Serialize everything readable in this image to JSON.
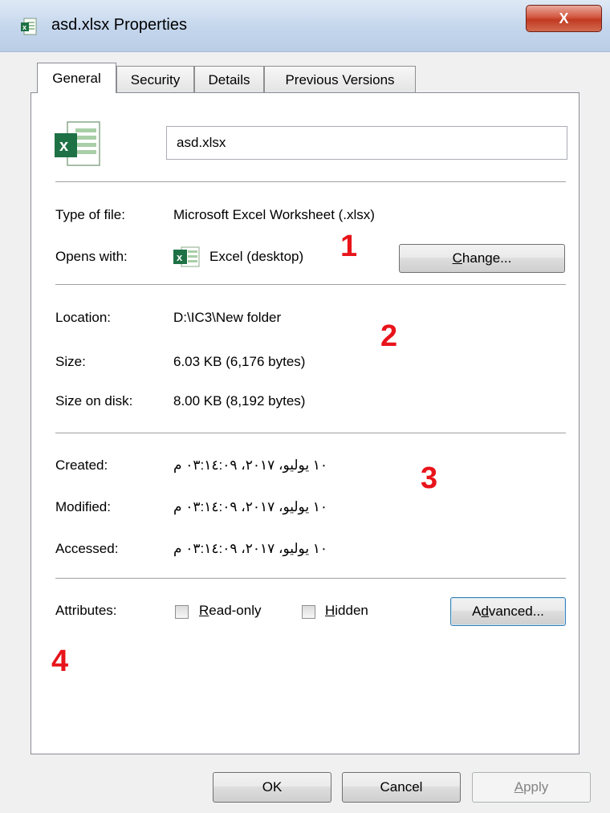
{
  "window": {
    "title": "asd.xlsx Properties",
    "close_label": "X"
  },
  "tabs": [
    {
      "label": "General",
      "active": true
    },
    {
      "label": "Security"
    },
    {
      "label": "Details"
    },
    {
      "label": "Previous Versions"
    }
  ],
  "file": {
    "name": "asd.xlsx",
    "type_label": "Type of file:",
    "type_value": "Microsoft Excel Worksheet (.xlsx)",
    "opens_label": "Opens with:",
    "opens_value": "Excel (desktop)",
    "change_prefix": "C",
    "change_rest": "hange..."
  },
  "location": {
    "location_label": "Location:",
    "location_value": "D:\\IC3\\New folder",
    "size_label": "Size:",
    "size_value": "6.03 KB (6,176 bytes)",
    "disk_label": "Size on disk:",
    "disk_value": "8.00 KB (8,192 bytes)"
  },
  "dates": {
    "created_label": "Created:",
    "created_value": "١٠ يوليو، ٢٠١٧، ٠٣:١٤:٠٩ م",
    "modified_label": "Modified:",
    "modified_value": "١٠ يوليو، ٢٠١٧، ٠٣:١٤:٠٩ م",
    "accessed_label": "Accessed:",
    "accessed_value": "١٠ يوليو، ٢٠١٧، ٠٣:١٤:٠٩ م"
  },
  "attributes": {
    "label": "Attributes:",
    "readonly_prefix": "R",
    "readonly_rest": "ead-only",
    "hidden_prefix": "H",
    "hidden_rest": "idden",
    "advanced_prefix": "A",
    "advanced_mid": "d",
    "advanced_rest": "vanced..."
  },
  "annotations": [
    "1",
    "2",
    "3",
    "4"
  ],
  "buttons": {
    "ok": "OK",
    "cancel": "Cancel",
    "apply_prefix": "A",
    "apply_rest": "pply"
  },
  "colors": {
    "annotation": "#e8141b",
    "excel_green": "#1e7145"
  }
}
